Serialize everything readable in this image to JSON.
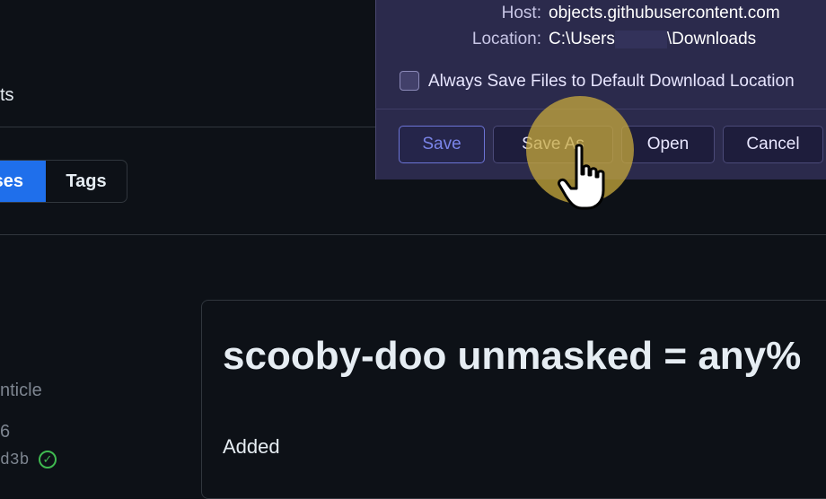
{
  "background": {
    "nav_partial": "ts",
    "tabs": {
      "active_label": "ses",
      "tags_label": "Tags"
    },
    "sidebar": {
      "line1": "nticle",
      "line2": "6",
      "line3": "d3b"
    },
    "release": {
      "title": "scooby-doo unmasked = any%",
      "section_heading": "Added"
    }
  },
  "dialog": {
    "host_label": "Host:",
    "host_value": "objects.githubusercontent.com",
    "location_label": "Location:",
    "location_prefix": "C:\\Users",
    "location_suffix": "\\Downloads",
    "always_save_label": "Always Save Files to Default Download Location",
    "buttons": {
      "save": "Save",
      "save_as": "Save As",
      "open": "Open",
      "cancel": "Cancel"
    }
  },
  "colors": {
    "github_bg": "#0d1117",
    "tab_active": "#1f6feb",
    "dialog_bg": "#2b2a4c",
    "cursor_highlight": "#c8aa3c",
    "verified_green": "#3fb950"
  }
}
